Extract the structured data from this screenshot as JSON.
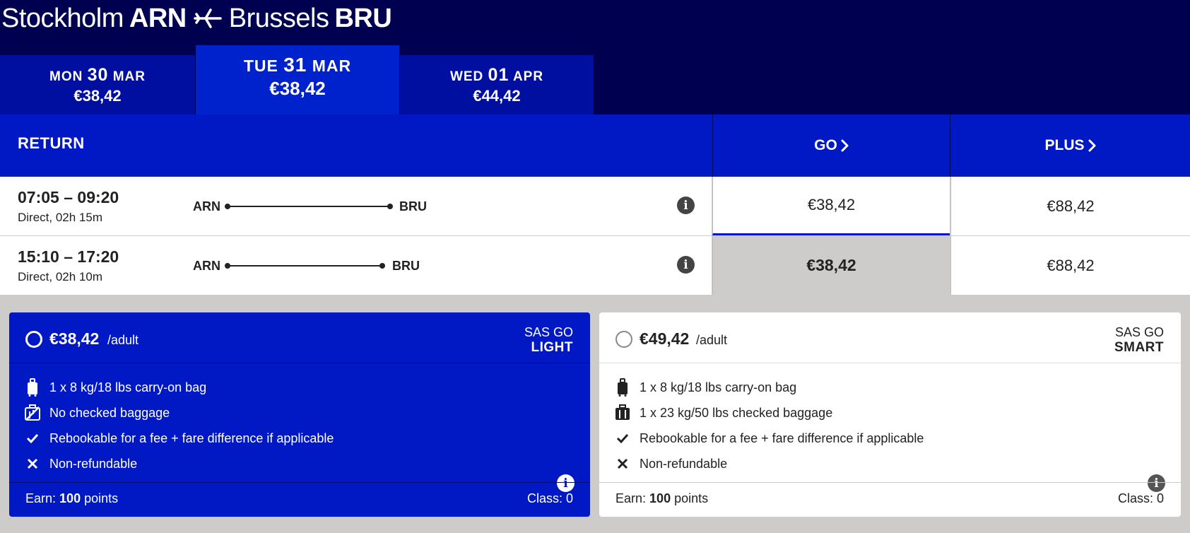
{
  "route": {
    "from_city": "Stockholm",
    "from_code": "ARN",
    "to_city": "Brussels",
    "to_code": "BRU",
    "icon": "airplane-icon"
  },
  "date_tabs": [
    {
      "dow": "MON",
      "day": "30",
      "month": "MAR",
      "price": "€38,42",
      "selected": false
    },
    {
      "dow": "TUE",
      "day": "31",
      "month": "MAR",
      "price": "€38,42",
      "selected": true
    },
    {
      "dow": "WED",
      "day": "01",
      "month": "APR",
      "price": "€44,42",
      "selected": false
    }
  ],
  "table": {
    "header_label": "RETURN",
    "columns": [
      {
        "label": "GO",
        "icon": "chevron-right-icon"
      },
      {
        "label": "PLUS",
        "icon": "chevron-right-icon"
      }
    ],
    "rows": [
      {
        "times": "07:05 – 09:20",
        "duration": "Direct, 02h 15m",
        "from": "ARN",
        "to": "BRU",
        "go_price": "€38,42",
        "plus_price": "€88,42"
      },
      {
        "times": "15:10 – 17:20",
        "duration": "Direct, 02h 10m",
        "from": "ARN",
        "to": "BRU",
        "go_price": "€38,42",
        "plus_price": "€88,42"
      }
    ]
  },
  "fares": [
    {
      "price": "€38,42",
      "per": "/adult",
      "brand_line1": "SAS GO",
      "brand_line2": "LIGHT",
      "selected": true,
      "features": [
        {
          "icon": "carry-on-bag-icon",
          "text": "1 x 8 kg/18 lbs carry-on bag"
        },
        {
          "icon": "no-checked-bag-icon",
          "text": "No checked baggage"
        },
        {
          "icon": "check-icon",
          "text": "Rebookable for a fee + fare difference if applicable"
        },
        {
          "icon": "close-icon",
          "text": "Non-refundable"
        }
      ],
      "earn_label": "Earn:",
      "earn_points": "100",
      "earn_unit": "points",
      "class_label": "Class: 0"
    },
    {
      "price": "€49,42",
      "per": "/adult",
      "brand_line1": "SAS GO",
      "brand_line2": "SMART",
      "selected": false,
      "features": [
        {
          "icon": "carry-on-bag-icon",
          "text": "1 x 8 kg/18 lbs carry-on bag"
        },
        {
          "icon": "checked-bag-icon",
          "text": "1 x 23 kg/50 lbs checked baggage"
        },
        {
          "icon": "check-icon",
          "text": "Rebookable for a fee + fare difference if applicable"
        },
        {
          "icon": "close-icon",
          "text": "Non-refundable"
        }
      ],
      "earn_label": "Earn:",
      "earn_points": "100",
      "earn_unit": "points",
      "class_label": "Class: 0"
    }
  ],
  "colors": {
    "page_bg": "#000050",
    "header_blue": "#0019c4",
    "tab_blue": "#000fa0",
    "selected_gray": "#cdcccb"
  }
}
